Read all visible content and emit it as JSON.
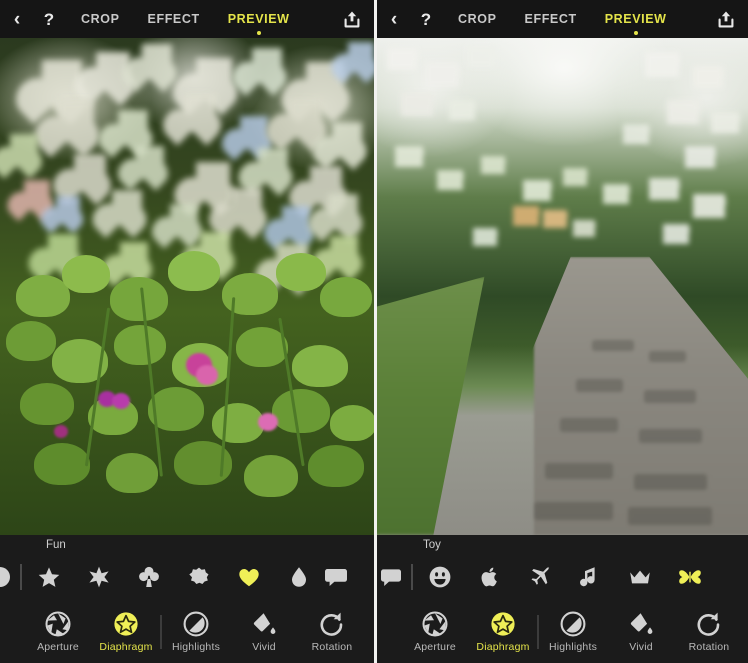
{
  "theme": {
    "accent": "#e4e44a",
    "toolbar_bg": "#151515",
    "panel_bg": "#1b1b1b",
    "text": "#c9c9c9"
  },
  "toolbar": {
    "back_icon": "chevron-left-icon",
    "back_label": "‹",
    "help_icon": "question-mark-icon",
    "help_label": "?",
    "share_icon": "share-upload-icon",
    "tabs": [
      {
        "label": "CROP",
        "active": false
      },
      {
        "label": "EFFECT",
        "active": false
      },
      {
        "label": "PREVIEW",
        "active": true
      }
    ]
  },
  "panels": [
    {
      "id": "left",
      "photo_description": "clover-leaves-with-pink-flowers",
      "bokeh_shape": "heart",
      "shape_strip": {
        "category_label": "Fun",
        "shapes": [
          {
            "name": "circle-shape",
            "selected": false,
            "partial": true
          },
          {
            "name": "star5-shape",
            "selected": false
          },
          {
            "name": "star6-shape",
            "selected": false
          },
          {
            "name": "clover-shape",
            "selected": false
          },
          {
            "name": "flower-shape",
            "selected": false
          },
          {
            "name": "heart-shape",
            "selected": true
          },
          {
            "name": "teardrop-shape",
            "selected": false
          },
          {
            "name": "speech-bubble-shape",
            "selected": false,
            "partial": true
          }
        ]
      },
      "tools": [
        {
          "label": "Aperture",
          "icon": "aperture-icon",
          "active": false
        },
        {
          "label": "Diaphragm",
          "icon": "diaphragm-star-icon",
          "active": true
        },
        {
          "label": "Highlights",
          "icon": "highlights-icon",
          "active": false
        },
        {
          "label": "Vivid",
          "icon": "paint-bucket-icon",
          "active": false
        },
        {
          "label": "Rotation",
          "icon": "rotate-right-icon",
          "active": false
        }
      ]
    },
    {
      "id": "right",
      "photo_description": "cobblestone-path-through-park",
      "bokeh_shape": "butterfly",
      "shape_strip": {
        "category_label": "Toy",
        "shapes": [
          {
            "name": "speech-bubble-shape",
            "selected": false,
            "partial": true
          },
          {
            "name": "smiley-shape",
            "selected": false
          },
          {
            "name": "apple-shape",
            "selected": false
          },
          {
            "name": "airplane-shape",
            "selected": false
          },
          {
            "name": "music-note-shape",
            "selected": false
          },
          {
            "name": "crown-shape",
            "selected": false
          },
          {
            "name": "butterfly-shape",
            "selected": true
          }
        ]
      },
      "tools": [
        {
          "label": "Aperture",
          "icon": "aperture-icon",
          "active": false
        },
        {
          "label": "Diaphragm",
          "icon": "diaphragm-star-icon",
          "active": true
        },
        {
          "label": "Highlights",
          "icon": "highlights-icon",
          "active": false
        },
        {
          "label": "Vivid",
          "icon": "paint-bucket-icon",
          "active": false
        },
        {
          "label": "Rotation",
          "icon": "rotate-right-icon",
          "active": false
        }
      ]
    }
  ]
}
